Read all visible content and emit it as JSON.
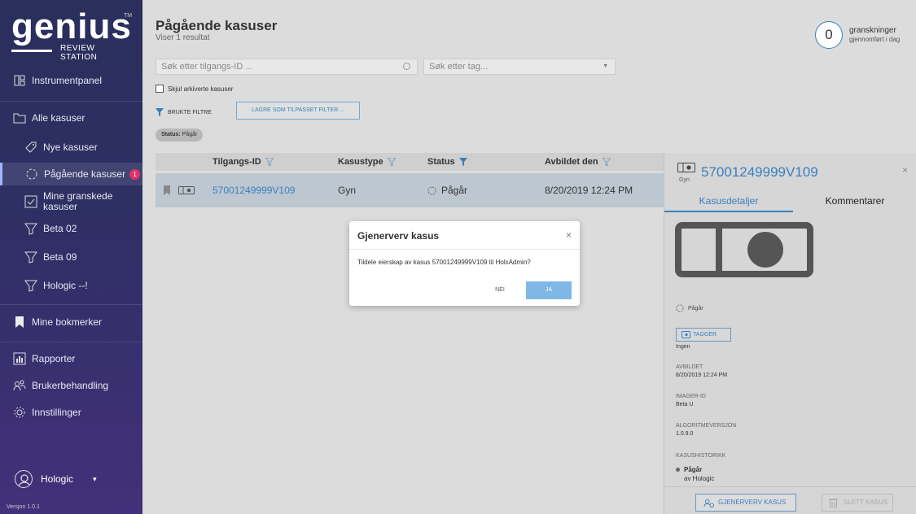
{
  "sidebar": {
    "logo": {
      "brand": "genius",
      "subtitle": "REVIEW STATION",
      "tm": "TM"
    },
    "items": [
      {
        "label": "Instrumentpanel"
      },
      {
        "label": "Alle kasuser"
      },
      {
        "label": "Nye kasuser"
      },
      {
        "label": "Pågående kasuser",
        "badge": "1"
      },
      {
        "label": "Mine granskede kasuser"
      },
      {
        "label": "Beta 02"
      },
      {
        "label": "Beta 09"
      },
      {
        "label": "Hologic --!"
      },
      {
        "label": "Mine bokmerker"
      },
      {
        "label": "Rapporter"
      },
      {
        "label": "Brukerbehandling"
      },
      {
        "label": "Innstillinger"
      }
    ],
    "user": {
      "name": "Hologic",
      "caret": "▾"
    },
    "version": "Versjon 1.0.1"
  },
  "header": {
    "title": "Pågående kasuser",
    "subtitle": "Viser 1 resultat",
    "counter": {
      "value": "0",
      "line1": "granskninger",
      "line2": "gjennomført i dag"
    }
  },
  "filters": {
    "search_placeholder": "Søk etter tilgangs-ID ...",
    "tag_placeholder": "Søk etter tag...",
    "hide_archived": "Skjul arkiverte kasuser",
    "applied_filters": "BRUKTE FILTRE",
    "save_filter": "LAGRE SOM TILPASSET FILTER ...",
    "chip_key": "Status:",
    "chip_value": "Pågår"
  },
  "table": {
    "columns": [
      "Tilgangs-ID",
      "Kasustype",
      "Status",
      "Avbildet den"
    ],
    "rows": [
      {
        "id": "57001249999V109",
        "type": "Gyn",
        "status": "Pågår",
        "date": "8/20/2019 12:24 PM"
      }
    ]
  },
  "panel": {
    "case_id": "57001249999V109",
    "type": "Gyn",
    "close": "×",
    "tabs": [
      "Kasusdetaljer",
      "Kommentarer"
    ],
    "status": "Pågår",
    "tagger_label": "TAGGER",
    "tagger_value": "Ingen",
    "imaged_label": "AVBILDET",
    "imaged_value": "8/20/2019 12:24 PM",
    "imager_label": "IMAGER-ID",
    "imager_value": "Beta U",
    "algo_label": "ALGORITMEVERSJON",
    "algo_value": "1.0.9.0",
    "history_label": "KASUSHISTORIKK",
    "history_status": "Pågår",
    "history_by": "av Hologic",
    "reclaim_button": "GJENERVERV KASUS",
    "delete_button": "SLETT KASUS"
  },
  "modal": {
    "title": "Gjenerverv kasus",
    "close": "×",
    "body": "Tildele eierskap av kasus 57001249999V109 til HolxAdmin?",
    "no": "NEI",
    "yes": "JA"
  },
  "colors": {
    "accent": "#3a7fbd",
    "sidebar": "#2e2f63",
    "badge": "#e0306a",
    "selected_row": "#bdc7d0",
    "yes_button": "#7fb8e6"
  }
}
